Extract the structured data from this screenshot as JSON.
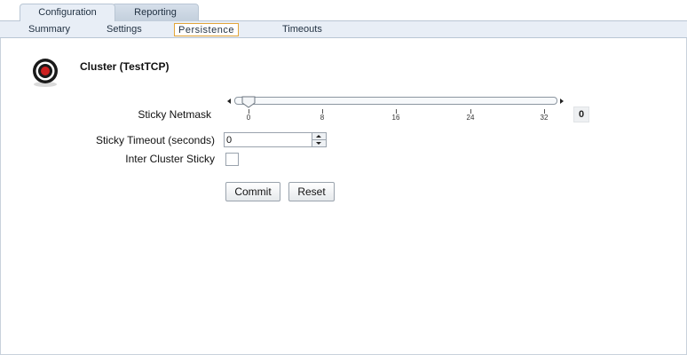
{
  "top_tabs": [
    {
      "label": "Configuration",
      "active": true
    },
    {
      "label": "Reporting",
      "active": false
    }
  ],
  "sub_tabs": [
    {
      "label": "Summary"
    },
    {
      "label": "Settings"
    },
    {
      "label": "Persistence",
      "selected": true
    },
    {
      "label": "Timeouts"
    }
  ],
  "cluster": {
    "title": "Cluster (TestTCP)",
    "icon": "target-icon"
  },
  "form": {
    "sticky_netmask": {
      "label": "Sticky Netmask",
      "value": "0",
      "min": 0,
      "max": 32,
      "ticks": [
        "0",
        "8",
        "16",
        "24",
        "32"
      ]
    },
    "sticky_timeout": {
      "label": "Sticky Timeout (seconds)",
      "value": "0"
    },
    "inter_cluster_sticky": {
      "label": "Inter Cluster Sticky",
      "checked": false
    }
  },
  "buttons": {
    "commit": "Commit",
    "reset": "Reset"
  },
  "colors": {
    "tab_bar": "#e8eef6",
    "selected_tab_border": "#e3a63a",
    "target_red": "#cc1f1f"
  }
}
